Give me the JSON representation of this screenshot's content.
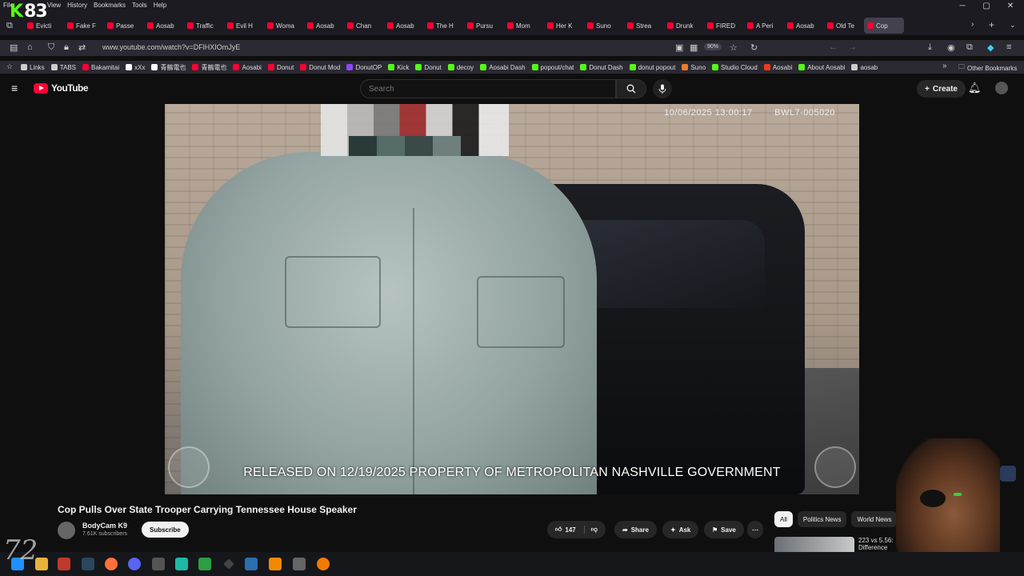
{
  "browser": {
    "menu": [
      "File",
      "View",
      "History",
      "Bookmarks",
      "Tools",
      "Help"
    ],
    "overlay_text": "83",
    "tabs": [
      {
        "label": "Evicti"
      },
      {
        "label": "Fake F"
      },
      {
        "label": "Passe"
      },
      {
        "label": "Aosab"
      },
      {
        "label": "Traffic"
      },
      {
        "label": "Evil H"
      },
      {
        "label": "Woma"
      },
      {
        "label": "Aosab"
      },
      {
        "label": "Chan"
      },
      {
        "label": "Aosab"
      },
      {
        "label": "The H"
      },
      {
        "label": "Pursu"
      },
      {
        "label": "Mom"
      },
      {
        "label": "Her K"
      },
      {
        "label": "Suno"
      },
      {
        "label": "Strea"
      },
      {
        "label": "Drunk"
      },
      {
        "label": "FIRED"
      },
      {
        "label": "A Peri"
      },
      {
        "label": "Aosab"
      },
      {
        "label": "Old Te"
      },
      {
        "label": "Cop"
      }
    ],
    "url": "www.youtube.com/watch?v=DFlHXIOmJyE",
    "zoom": "90%",
    "bookmarks": [
      {
        "label": "Links",
        "color": "#cccccc"
      },
      {
        "label": "TABS",
        "color": "#cccccc"
      },
      {
        "label": "Bakamitai",
        "color": "#ff0033"
      },
      {
        "label": "xXx",
        "color": "#ffffff"
      },
      {
        "label": "青鶴電也",
        "color": "#ffffff"
      },
      {
        "label": "青鶴電也",
        "color": "#ff0033"
      },
      {
        "label": "Aosabi",
        "color": "#ff0033"
      },
      {
        "label": "Donut",
        "color": "#ff0033"
      },
      {
        "label": "Donut Mod",
        "color": "#ff0033"
      },
      {
        "label": "DonutOP",
        "color": "#9146ff"
      },
      {
        "label": "Kick",
        "color": "#53fc18"
      },
      {
        "label": "Donut",
        "color": "#53fc18"
      },
      {
        "label": "decoy",
        "color": "#53fc18"
      },
      {
        "label": "Aosabi Dash",
        "color": "#53fc18"
      },
      {
        "label": "popout/chat",
        "color": "#53fc18"
      },
      {
        "label": "Donut Dash",
        "color": "#53fc18"
      },
      {
        "label": "donut popout",
        "color": "#53fc18"
      },
      {
        "label": "Suno",
        "color": "#f07b2a"
      },
      {
        "label": "Studio Cloud",
        "color": "#53fc18"
      },
      {
        "label": "Aosabi",
        "color": "#f03a17"
      },
      {
        "label": "About Aosabi",
        "color": "#53fc18"
      },
      {
        "label": "aosab",
        "color": "#cccccc"
      }
    ],
    "other_bookmarks": "Other Bookmarks"
  },
  "youtube": {
    "logo_text": "YouTube",
    "search_placeholder": "Search",
    "create_label": "Create",
    "video": {
      "timestamp": "10/06/2025 13:00:17",
      "camera_id": "BWL7-005020",
      "watermark": "RELEASED ON 12/19/2025 PROPERTY OF METROPOLITAN NASHVILLE GOVERNMENT"
    },
    "title": "Cop Pulls Over State Trooper Carrying Tennessee House Speaker",
    "channel": {
      "name": "BodyCam K9",
      "subscribers": "7.61K subscribers"
    },
    "subscribe_label": "Subscribe",
    "likes": "147",
    "share_label": "Share",
    "ask_label": "Ask",
    "save_label": "Save",
    "chips": [
      "All",
      "Politics News",
      "World News"
    ],
    "recommendation_title": "223 vs 5.56:",
    "recommendation_title_line2": "Difference"
  },
  "overlay_signature": "72"
}
